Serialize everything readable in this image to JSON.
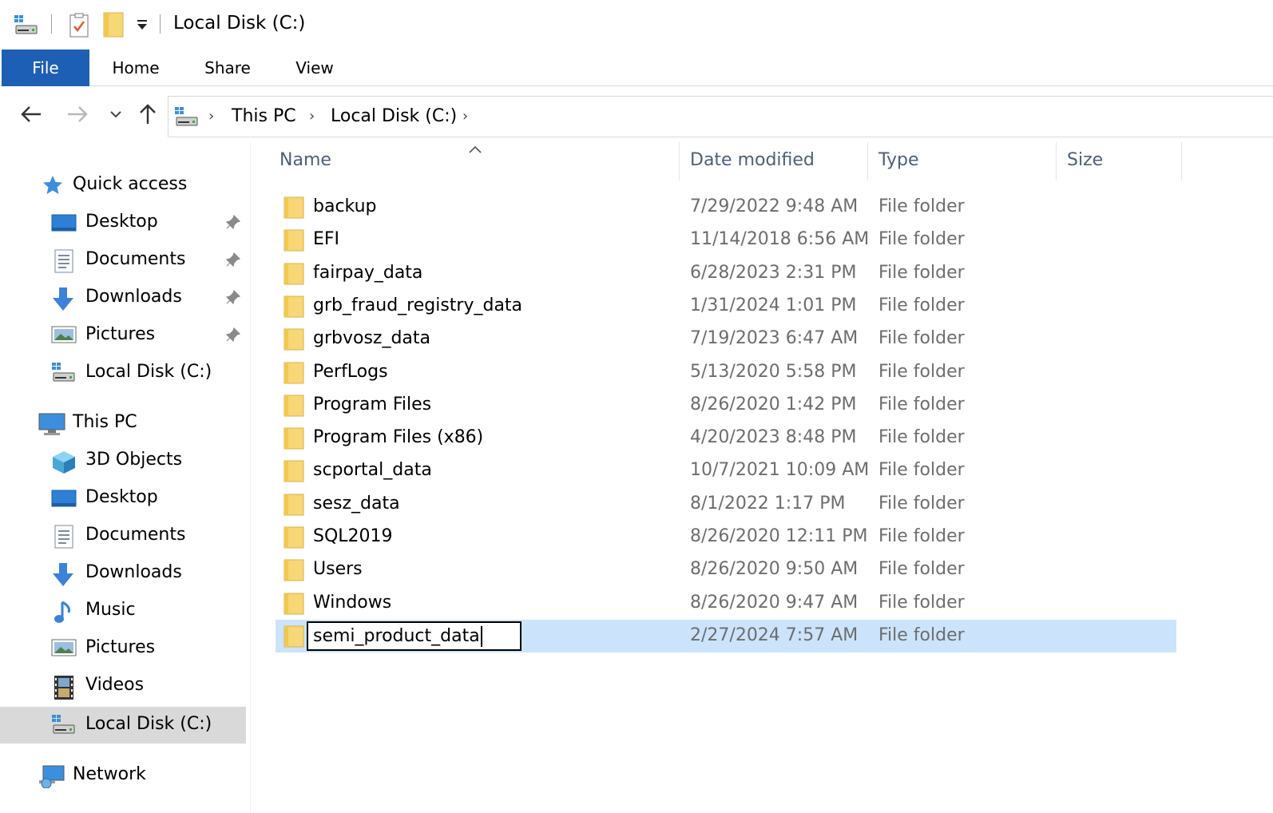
{
  "window": {
    "title": "Local Disk (C:)"
  },
  "ribbon": {
    "tabs": [
      "File",
      "Home",
      "Share",
      "View"
    ]
  },
  "address": {
    "crumbs": [
      "This PC",
      "Local Disk (C:)"
    ]
  },
  "sidebar": {
    "quick_access": "Quick access",
    "quick_items": [
      "Desktop",
      "Documents",
      "Downloads",
      "Pictures",
      "Local Disk (C:)"
    ],
    "this_pc": "This PC",
    "pc_items": [
      "3D Objects",
      "Desktop",
      "Documents",
      "Downloads",
      "Music",
      "Pictures",
      "Videos",
      "Local Disk (C:)"
    ],
    "network": "Network"
  },
  "columns": {
    "name": "Name",
    "date": "Date modified",
    "type": "Type",
    "size": "Size"
  },
  "files": [
    {
      "name": "backup",
      "date": "7/29/2022 9:48 AM",
      "type": "File folder"
    },
    {
      "name": "EFI",
      "date": "11/14/2018 6:56 AM",
      "type": "File folder"
    },
    {
      "name": "fairpay_data",
      "date": "6/28/2023 2:31 PM",
      "type": "File folder"
    },
    {
      "name": "grb_fraud_registry_data",
      "date": "1/31/2024 1:01 PM",
      "type": "File folder"
    },
    {
      "name": "grbvosz_data",
      "date": "7/19/2023 6:47 AM",
      "type": "File folder"
    },
    {
      "name": "PerfLogs",
      "date": "5/13/2020 5:58 PM",
      "type": "File folder"
    },
    {
      "name": "Program Files",
      "date": "8/26/2020 1:42 PM",
      "type": "File folder"
    },
    {
      "name": "Program Files (x86)",
      "date": "4/20/2023 8:48 PM",
      "type": "File folder"
    },
    {
      "name": "scportal_data",
      "date": "10/7/2021 10:09 AM",
      "type": "File folder"
    },
    {
      "name": "sesz_data",
      "date": "8/1/2022 1:17 PM",
      "type": "File folder"
    },
    {
      "name": "SQL2019",
      "date": "8/26/2020 12:11 PM",
      "type": "File folder"
    },
    {
      "name": "Users",
      "date": "8/26/2020 9:50 AM",
      "type": "File folder"
    },
    {
      "name": "Windows",
      "date": "8/26/2020 9:47 AM",
      "type": "File folder"
    },
    {
      "name": "semi_product_data",
      "date": "2/27/2024 7:57 AM",
      "type": "File folder",
      "renaming": true
    }
  ],
  "colors": {
    "file_tab": "#1d5fb4",
    "selection": "#cce4fb",
    "sidebar_selected": "#d9d9d9",
    "folder": "#f7d776"
  }
}
